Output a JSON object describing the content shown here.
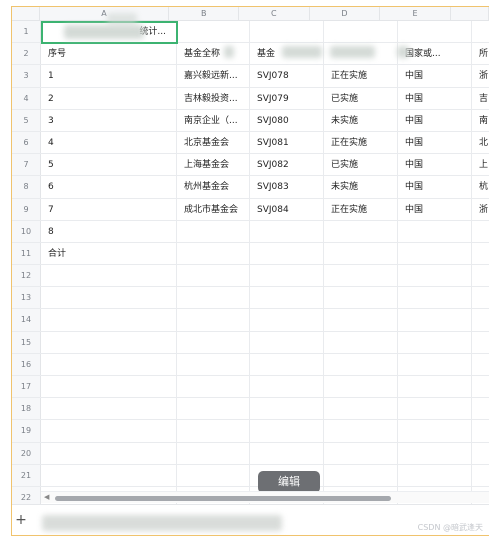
{
  "columns": [
    "A",
    "B",
    "C",
    "D",
    "E"
  ],
  "row_numbers": [
    "1",
    "2",
    "3",
    "4",
    "5",
    "6",
    "7",
    "8",
    "9",
    "10",
    "11",
    "12",
    "13",
    "14",
    "15",
    "16",
    "17",
    "18",
    "19",
    "20",
    "21",
    "22"
  ],
  "title_cell": "统计...",
  "headers": {
    "a": "序号",
    "b": "基金全称",
    "c": "基金",
    "e": "国家或...",
    "f": "所"
  },
  "rows": [
    {
      "a": "1",
      "b": "嘉兴毅远新...",
      "c": "SVJ078",
      "d": "正在实施",
      "e": "中国",
      "f": "浙"
    },
    {
      "a": "2",
      "b": "吉林毅投资...",
      "c": "SVJ079",
      "d": "已实施",
      "e": "中国",
      "f": "吉"
    },
    {
      "a": "3",
      "b": "南京企业（...",
      "c": "SVJ080",
      "d": "未实施",
      "e": "中国",
      "f": "南"
    },
    {
      "a": "4",
      "b": "北京基金会",
      "c": "SVJ081",
      "d": "正在实施",
      "e": "中国",
      "f": "北"
    },
    {
      "a": "5",
      "b": "上海基金会",
      "c": "SVJ082",
      "d": "已实施",
      "e": "中国",
      "f": "上"
    },
    {
      "a": "6",
      "b": "杭州基金会",
      "c": "SVJ083",
      "d": "未实施",
      "e": "中国",
      "f": "杭"
    },
    {
      "a": "7",
      "b": "成北市基金会",
      "c": "SVJ084",
      "d": "正在实施",
      "e": "中国",
      "f": "浙"
    },
    {
      "a": "8",
      "b": "",
      "c": "",
      "d": "",
      "e": "",
      "f": ""
    },
    {
      "a": "合计",
      "b": "",
      "c": "",
      "d": "",
      "e": "",
      "f": ""
    }
  ],
  "edit_button": "编辑",
  "add_sheet_icon": "+",
  "scroll_left_icon": "◀",
  "watermark": "CSDN @暗武逢天",
  "accent_color": "#3cb371"
}
